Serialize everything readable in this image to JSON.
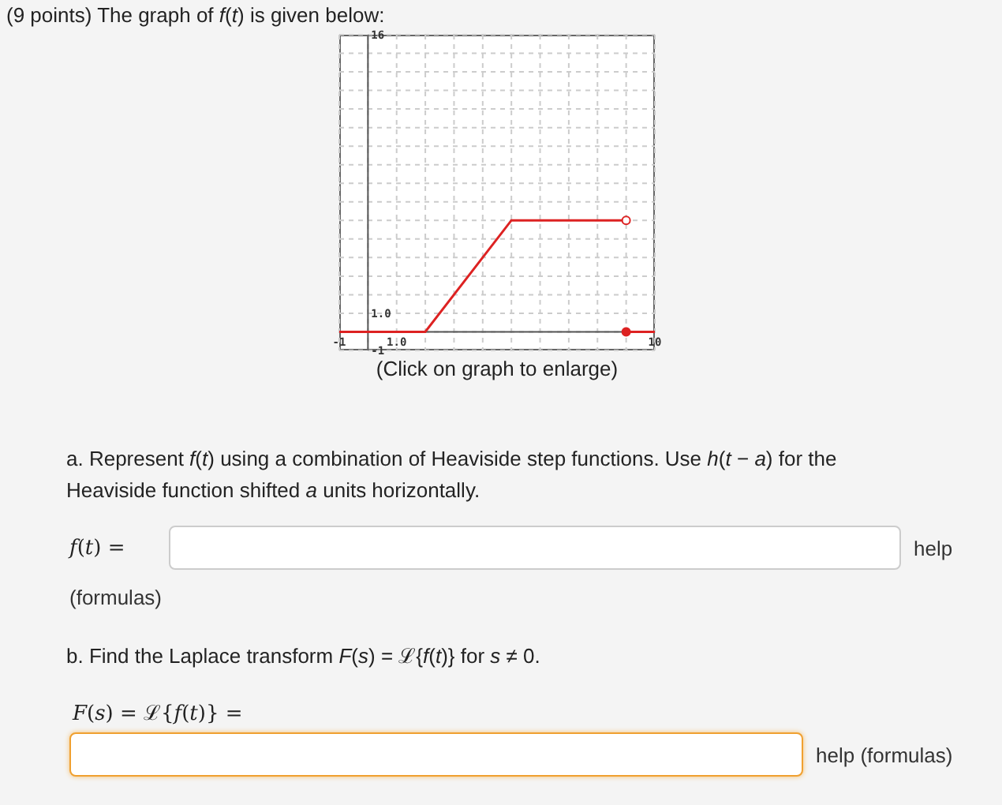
{
  "header": "(9 points) The graph of *f*(*t*) is given below:",
  "graph": {
    "caption": "(Click on graph to enlarge)",
    "chart_data": {
      "type": "line",
      "xlim": [
        -1,
        10
      ],
      "ylim": [
        -1,
        16
      ],
      "xticks": [
        {
          "value": -1,
          "label": "-1"
        },
        {
          "value": 1,
          "label": "1.0"
        },
        {
          "value": 10,
          "label": "10"
        }
      ],
      "yticks": [
        {
          "value": -1,
          "label": "-1"
        },
        {
          "value": 1,
          "label": "1.0"
        },
        {
          "value": 16,
          "label": "16"
        }
      ],
      "x": [
        -1,
        2,
        5,
        9,
        10
      ],
      "series": [
        {
          "color": "#dd2222",
          "values": [
            0,
            0,
            6,
            6,
            null
          ]
        },
        {
          "color": "#dd2222",
          "values": [
            null,
            null,
            null,
            0,
            0
          ]
        }
      ]
    }
  },
  "part_a": {
    "prompt": "a. Represent *f*(*t*) using a combination of Heaviside step functions. Use *h*(*t* − *a*) for the Heaviside function shifted *a* units horizontally.",
    "label": "*f*(*t*) =",
    "focused": false,
    "help": "help",
    "formulas": "(formulas)"
  },
  "part_b": {
    "prompt": "b. Find the Laplace transform *F*(*s*) = ℒ{*f*(*t*)} for *s* ≠ 0.",
    "label": "*F*(*s*) = ℒ{*f*(*t*)} =",
    "focused": true,
    "help": "help (formulas)"
  }
}
